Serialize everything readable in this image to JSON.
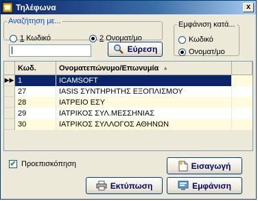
{
  "window": {
    "title": "Τηλέφωνα",
    "close": "x"
  },
  "search": {
    "legend": "Αναζήτηση με...",
    "options": [
      {
        "key": "1",
        "label": "Κωδικό",
        "selected": false
      },
      {
        "key": "2",
        "label": "Ονοματ/μο",
        "selected": true
      }
    ],
    "input_value": "",
    "button_label": "Εύρεση"
  },
  "view": {
    "legend": "Εμφάνιση κατά...",
    "options": [
      {
        "label": "Κωδικό",
        "selected": false
      },
      {
        "label": "Ονοματ/μο",
        "selected": true
      }
    ]
  },
  "grid": {
    "columns": [
      "Κωδ.",
      "Ονοματεπώνυμο/Επωνυμία"
    ],
    "sorted_column": 1,
    "rows": [
      {
        "code": "1",
        "name": "ICAMSOFT",
        "selected": true
      },
      {
        "code": "27",
        "name": "ΙASIS ΣΥΝΤΗΡΗΤΗΣ ΕΞΟΠΛΙΣΜΟΥ",
        "selected": false
      },
      {
        "code": "28",
        "name": "ΙΑΤΡΕΙΟ ΕΣΥ",
        "selected": false
      },
      {
        "code": "29",
        "name": "ΙΑΤΡΙΚΟΣ ΣΥΛ.ΜΕΣΣΗΝΙΑΣ",
        "selected": false
      },
      {
        "code": "30",
        "name": "ΙΑΤΡΙΚΟΣ ΣΥΛΛΟΓΟΣ ΑΘΗΝΩΝ",
        "selected": false
      }
    ]
  },
  "preview": {
    "label": "Προεπισκόπηση",
    "checked": true
  },
  "buttons": {
    "insert": "Εισαγωγή",
    "print": "Εκτύπωση",
    "show": "Εμφάνιση"
  },
  "colors": {
    "selection": "#0a246a",
    "row_alt": "#fffbdc",
    "title_bar": "#0a246a"
  }
}
